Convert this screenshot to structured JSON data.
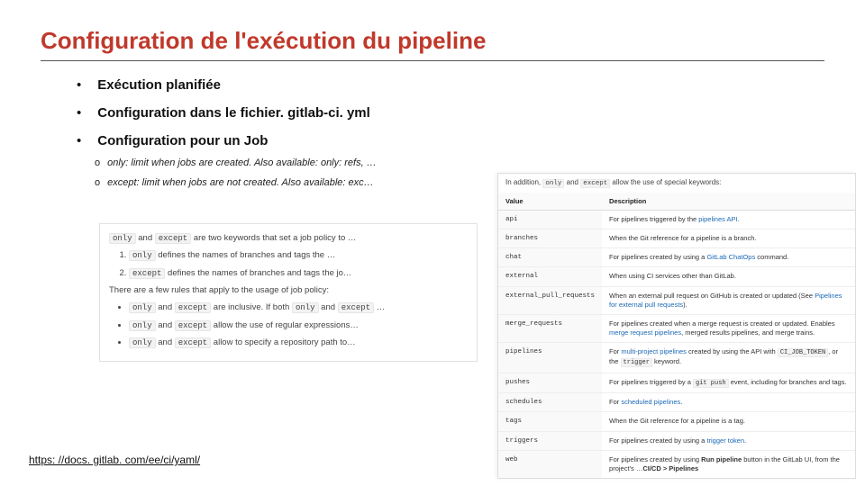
{
  "title": "Configuration de l'exécution du pipeline",
  "bullets": [
    "Exécution planifiée",
    "Configuration dans le fichier. gitlab-ci. yml",
    "Configuration pour un Job"
  ],
  "sub": {
    "only": "only: limit when jobs are created. Also available: only: refs, …",
    "except": "except: limit when jobs are not created. Also available: exc…"
  },
  "doc": {
    "p1a": " and ",
    "p1b": " are two keywords that set a job policy to …",
    "l1a": " defines the names of branches and tags the …",
    "l2a": " defines the names of branches and tags the jo…",
    "rules_intro": "There are a few rules that apply to the usage of job policy:",
    "r1": " are inclusive. If both ",
    "r1b": " and ",
    "r1c": " …",
    "r2": " allow the use of regular expressions…",
    "r3": " allow to specify a repository path to…",
    "only": "only",
    "except": "except",
    "and": " and "
  },
  "table": {
    "intro_a": "In addition, ",
    "intro_b": " allow the use of special keywords:",
    "h1": "Value",
    "h2": "Description",
    "rows": [
      {
        "v": "api",
        "d_pre": "For pipelines triggered by the ",
        "d_link": "pipelines API",
        "d_post": "."
      },
      {
        "v": "branches",
        "d": "When the Git reference for a pipeline is a branch."
      },
      {
        "v": "chat",
        "d_pre": "For pipelines created by using a ",
        "d_link": "GitLab ChatOps",
        "d_post": " command."
      },
      {
        "v": "external",
        "d": "When using CI services other than GitLab."
      },
      {
        "v": "external_pull_requests",
        "d_pre": "When an external pull request on GitHub is created or updated (See ",
        "d_link": "Pipelines for external pull requests",
        "d_post": ")."
      },
      {
        "v": "merge_requests",
        "d_pre": "For pipelines created when a merge request is created or updated. Enables ",
        "d_link": "merge request pipelines",
        "d_post": ", merged results pipelines, and merge trains."
      },
      {
        "v": "pipelines",
        "d_pre": "For ",
        "d_link": "multi-project pipelines",
        "d_mid": " created by using the API with ",
        "d_code": "CI_JOB_TOKEN",
        "d_post2": ", or the ",
        "d_code2": "trigger",
        "d_post3": " keyword."
      },
      {
        "v": "pushes",
        "d_pre": "For pipelines triggered by a ",
        "d_code": "git push",
        "d_post": " event, including for branches and tags."
      },
      {
        "v": "schedules",
        "d_pre": "For ",
        "d_link": "scheduled pipelines",
        "d_post": "."
      },
      {
        "v": "tags",
        "d": "When the Git reference for a pipeline is a tag."
      },
      {
        "v": "triggers",
        "d_pre": "For pipelines created by using a ",
        "d_link": "trigger token",
        "d_post": "."
      },
      {
        "v": "web",
        "d_pre": "For pipelines created by using ",
        "d_b": "Run pipeline",
        "d_mid": " button in the GitLab UI, from the project's ",
        "d_b2": "CI/CD > Pipelines",
        "d_post": " …"
      }
    ]
  },
  "footer": "https: //docs. gitlab. com/ee/ci/yaml/"
}
